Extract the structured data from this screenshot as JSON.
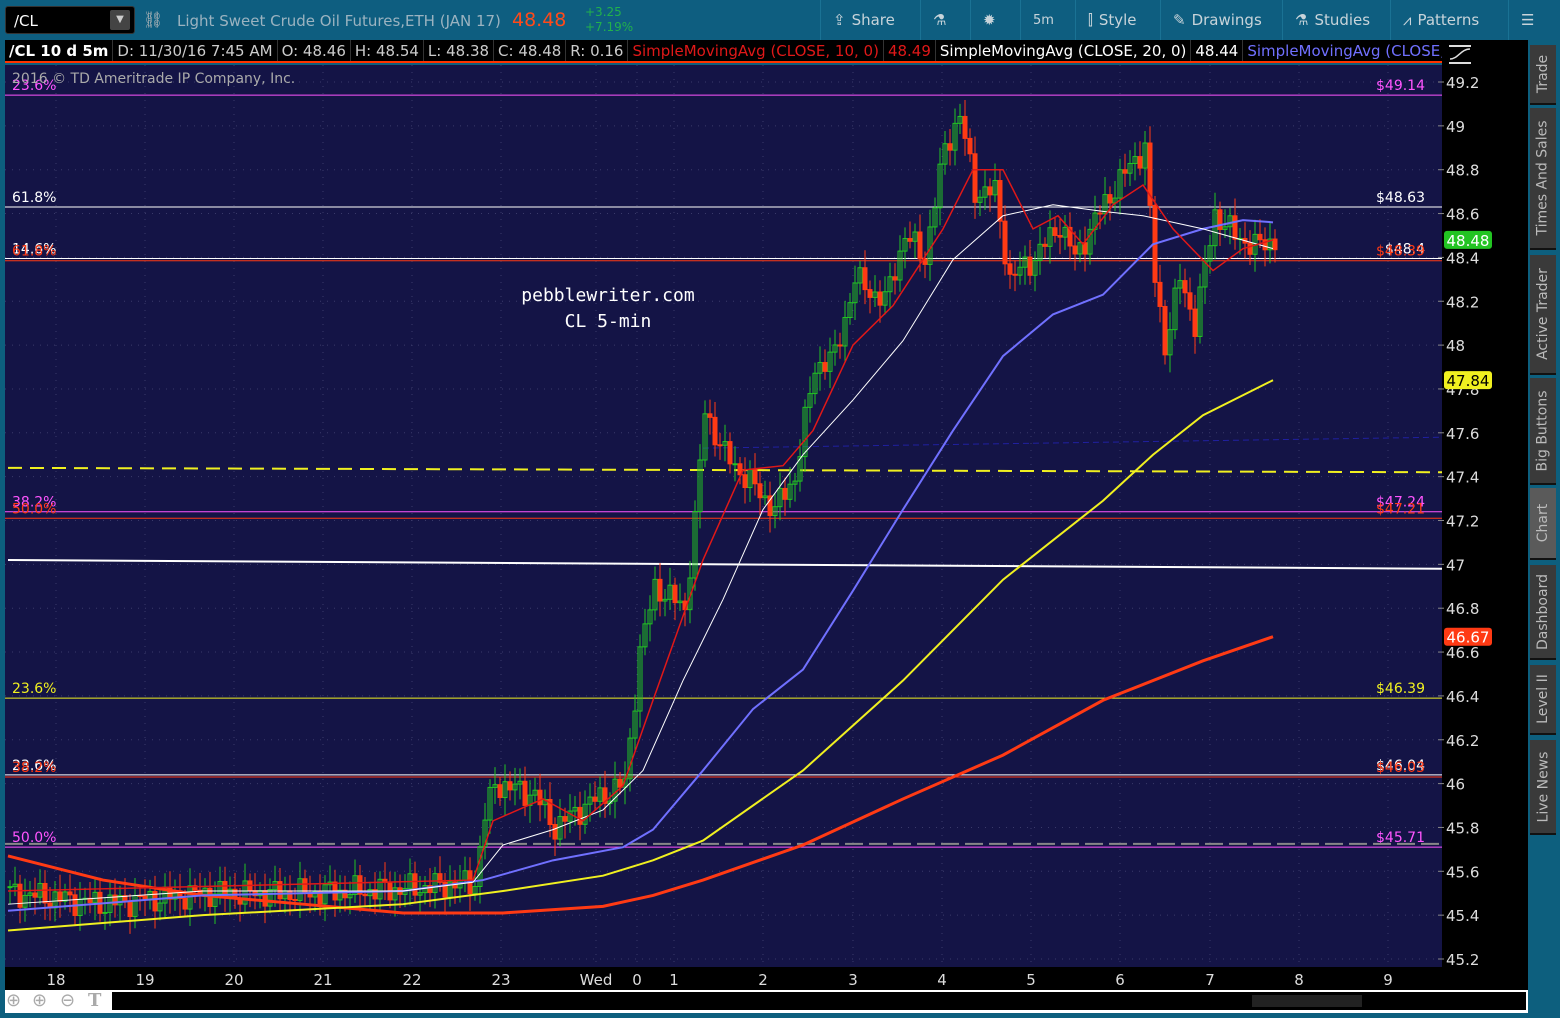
{
  "toolbar": {
    "symbol": "/CL",
    "description": "Light Sweet Crude Oil Futures,ETH (JAN 17)",
    "last": "48.48",
    "change": "+3.25",
    "change_pct": "+7.19%",
    "share": "Share",
    "interval": "5m",
    "style": "Style",
    "drawings": "Drawings",
    "studies": "Studies",
    "patterns": "Patterns"
  },
  "info": {
    "title": "/CL 10 d 5m",
    "date": "D: 11/30/16 7:45 AM",
    "open": "O: 48.46",
    "high": "H: 48.54",
    "low": "L: 48.38",
    "close": "C: 48.48",
    "range": "R: 0.16",
    "sma10": "SimpleMovingAvg (CLOSE, 10, 0)",
    "sma10_val": "48.49",
    "sma20": "SimpleMovingAvg (CLOSE, 20, 0)",
    "sma20_val": "48.44",
    "sma3": "SimpleMovingAvg (CLOSE,..."
  },
  "copyright": "2016 © TD Ameritrade IP Company, Inc.",
  "watermark": {
    "line1": "pebblewriter.com",
    "line2": "CL 5-min"
  },
  "tabs": [
    "Trade",
    "Times And Sales",
    "Active Trader",
    "Big Buttons",
    "Chart",
    "Dashboard",
    "Level II",
    "Live News"
  ],
  "colors": {
    "bg": "#141446",
    "up": "#22c422",
    "down": "#ff3a14",
    "sma10": "#e01818",
    "sma20": "#ffffff",
    "sma50": "#7070ff",
    "sma100": "#f0f020",
    "sma200": "#ff3a14"
  },
  "chart_data": {
    "type": "candlestick",
    "ylim": [
      45.2,
      49.2
    ],
    "yticks": [
      "49.2",
      "49",
      "48.8",
      "48.6",
      "48.4",
      "48.2",
      "48",
      "47.8",
      "47.6",
      "47.4",
      "47.2",
      "47",
      "46.8",
      "46.6",
      "46.4",
      "46.2",
      "46",
      "45.8",
      "45.6",
      "45.4",
      "45.2"
    ],
    "xticks": [
      {
        "label": "18",
        "bar": 9.6
      },
      {
        "label": "19",
        "bar": 27.4
      },
      {
        "label": "20",
        "bar": 45.2
      },
      {
        "label": "21",
        "bar": 63
      },
      {
        "label": "22",
        "bar": 80.8
      },
      {
        "label": "23",
        "bar": 98.6
      },
      {
        "label": "Wed",
        "bar": 117.6
      },
      {
        "label": "0",
        "bar": 125.8
      },
      {
        "label": "1",
        "bar": 133.2
      },
      {
        "label": "2",
        "bar": 151
      },
      {
        "label": "3",
        "bar": 169
      },
      {
        "label": "4",
        "bar": 186.8
      },
      {
        "label": "5",
        "bar": 204.6
      },
      {
        "label": "6",
        "bar": 222.4
      },
      {
        "label": "7",
        "bar": 240.4
      },
      {
        "label": "8",
        "bar": 258.2
      },
      {
        "label": "9",
        "bar": 276
      }
    ],
    "close_keypoints": [
      [
        1,
        45.5
      ],
      [
        19,
        45.45
      ],
      [
        39,
        45.5
      ],
      [
        59,
        45.5
      ],
      [
        79,
        45.52
      ],
      [
        93,
        45.55
      ],
      [
        95,
        45.85
      ],
      [
        97,
        46.0
      ],
      [
        105,
        45.95
      ],
      [
        109,
        45.8
      ],
      [
        115,
        45.9
      ],
      [
        123,
        46.0
      ],
      [
        126,
        46.6
      ],
      [
        129,
        46.9
      ],
      [
        135,
        46.8
      ],
      [
        137,
        47.2
      ],
      [
        139,
        47.7
      ],
      [
        143,
        47.5
      ],
      [
        147,
        47.4
      ],
      [
        153,
        47.25
      ],
      [
        157,
        47.4
      ],
      [
        161,
        47.9
      ],
      [
        165,
        47.95
      ],
      [
        169,
        48.3
      ],
      [
        175,
        48.2
      ],
      [
        179,
        48.5
      ],
      [
        183,
        48.4
      ],
      [
        187,
        48.9
      ],
      [
        190,
        49.05
      ],
      [
        193,
        48.7
      ],
      [
        197,
        48.7
      ],
      [
        200,
        48.3
      ],
      [
        205,
        48.4
      ],
      [
        210,
        48.55
      ],
      [
        213,
        48.4
      ],
      [
        219,
        48.65
      ],
      [
        225,
        48.85
      ],
      [
        227,
        48.9
      ],
      [
        229,
        48.3
      ],
      [
        231,
        48.0
      ],
      [
        234,
        48.3
      ],
      [
        237,
        48.1
      ],
      [
        241,
        48.6
      ],
      [
        245,
        48.5
      ],
      [
        249,
        48.45
      ],
      [
        253,
        48.48
      ]
    ],
    "series": [
      {
        "name": "SMA200",
        "color": "#ff3a14",
        "width": 3,
        "points": [
          [
            0,
            45.67
          ],
          [
            19,
            45.56
          ],
          [
            39,
            45.49
          ],
          [
            59,
            45.45
          ],
          [
            79,
            45.41
          ],
          [
            99,
            45.41
          ],
          [
            119,
            45.44
          ],
          [
            129,
            45.49
          ],
          [
            139,
            45.56
          ],
          [
            159,
            45.72
          ],
          [
            179,
            45.93
          ],
          [
            199,
            46.13
          ],
          [
            219,
            46.38
          ],
          [
            239,
            46.56
          ],
          [
            253,
            46.67
          ]
        ]
      },
      {
        "name": "SMA100",
        "color": "#f0f020",
        "width": 2,
        "points": [
          [
            0,
            45.33
          ],
          [
            39,
            45.4
          ],
          [
            79,
            45.45
          ],
          [
            99,
            45.51
          ],
          [
            119,
            45.58
          ],
          [
            129,
            45.65
          ],
          [
            139,
            45.74
          ],
          [
            159,
            46.06
          ],
          [
            179,
            46.47
          ],
          [
            199,
            46.93
          ],
          [
            219,
            47.29
          ],
          [
            229,
            47.5
          ],
          [
            239,
            47.68
          ],
          [
            253,
            47.84
          ]
        ]
      },
      {
        "name": "SMA50",
        "color": "#7070ff",
        "width": 2,
        "points": [
          [
            0,
            45.42
          ],
          [
            39,
            45.49
          ],
          [
            79,
            45.51
          ],
          [
            95,
            45.56
          ],
          [
            109,
            45.65
          ],
          [
            123,
            45.71
          ],
          [
            129,
            45.79
          ],
          [
            139,
            46.06
          ],
          [
            149,
            46.34
          ],
          [
            159,
            46.52
          ],
          [
            169,
            46.88
          ],
          [
            179,
            47.25
          ],
          [
            189,
            47.61
          ],
          [
            199,
            47.95
          ],
          [
            209,
            48.14
          ],
          [
            219,
            48.23
          ],
          [
            229,
            48.46
          ],
          [
            239,
            48.53
          ],
          [
            247,
            48.57
          ],
          [
            253,
            48.56
          ]
        ]
      },
      {
        "name": "SMA20",
        "color": "#ffffff",
        "width": 1,
        "points": [
          [
            0,
            45.45
          ],
          [
            39,
            45.51
          ],
          [
            79,
            45.51
          ],
          [
            93,
            45.55
          ],
          [
            99,
            45.72
          ],
          [
            109,
            45.79
          ],
          [
            119,
            45.88
          ],
          [
            127,
            46.06
          ],
          [
            135,
            46.47
          ],
          [
            143,
            46.84
          ],
          [
            151,
            47.25
          ],
          [
            159,
            47.5
          ],
          [
            169,
            47.75
          ],
          [
            179,
            48.02
          ],
          [
            189,
            48.39
          ],
          [
            199,
            48.59
          ],
          [
            209,
            48.64
          ],
          [
            219,
            48.61
          ],
          [
            227,
            48.59
          ],
          [
            231,
            48.57
          ],
          [
            239,
            48.53
          ],
          [
            253,
            48.44
          ]
        ]
      },
      {
        "name": "SMA10",
        "color": "#e01818",
        "width": 1.5,
        "points": [
          [
            0,
            45.51
          ],
          [
            93,
            45.56
          ],
          [
            97,
            45.83
          ],
          [
            107,
            45.93
          ],
          [
            115,
            45.83
          ],
          [
            123,
            45.99
          ],
          [
            129,
            46.38
          ],
          [
            139,
            47.02
          ],
          [
            147,
            47.43
          ],
          [
            155,
            47.45
          ],
          [
            161,
            47.61
          ],
          [
            169,
            48.0
          ],
          [
            177,
            48.18
          ],
          [
            187,
            48.53
          ],
          [
            193,
            48.8
          ],
          [
            199,
            48.8
          ],
          [
            205,
            48.53
          ],
          [
            210,
            48.59
          ],
          [
            215,
            48.46
          ],
          [
            221,
            48.64
          ],
          [
            227,
            48.73
          ],
          [
            233,
            48.53
          ],
          [
            241,
            48.34
          ],
          [
            247,
            48.44
          ],
          [
            253,
            48.48
          ]
        ]
      }
    ],
    "trendlines": [
      {
        "name": "yellow-dashed-trendline",
        "color": "#f0f020",
        "width": 2,
        "dash": "14,8",
        "from": [
          0,
          47.44
        ],
        "to": [
          287,
          47.42
        ]
      },
      {
        "name": "white-trendline",
        "color": "#ffffff",
        "width": 2,
        "dash": "",
        "from": [
          0,
          47.02
        ],
        "to": [
          287,
          46.98
        ]
      },
      {
        "name": "navy-dashed-trendline",
        "color": "#2020a0",
        "width": 1,
        "dash": "6,4",
        "from": [
          139,
          47.53
        ],
        "to": [
          287,
          47.58
        ]
      }
    ],
    "fib_levels": [
      {
        "price": 49.14,
        "color": "#ff55ff",
        "left": "23.6%",
        "right": "$49.14"
      },
      {
        "price": 48.63,
        "color": "#ffffff",
        "left": "61.8%",
        "right": "$48.63"
      },
      {
        "price": 48.395,
        "color": "#ffffff",
        "left": "14.6%",
        "right": "$48.4"
      },
      {
        "price": 48.385,
        "color": "#ff3a14",
        "left": "61.8%",
        "right": "$48.39"
      },
      {
        "price": 47.24,
        "color": "#ff55ff",
        "left": "38.2%",
        "right": "$47.24"
      },
      {
        "price": 47.21,
        "color": "#ff3a14",
        "left": "50.0%",
        "right": "$47.21"
      },
      {
        "price": 46.39,
        "color": "#f0f020",
        "left": "23.6%",
        "right": "$46.39"
      },
      {
        "price": 46.04,
        "color": "#ffffff",
        "left": "23.6%",
        "right": "$46.04"
      },
      {
        "price": 46.03,
        "color": "#ff3a14",
        "left": "38.2%",
        "right": "$46.03"
      },
      {
        "price": 45.71,
        "color": "#ff55ff",
        "left": "50.0%",
        "right": "$45.71"
      }
    ],
    "price_badges": [
      {
        "value": "48.48",
        "price": 48.48,
        "bg": "#22c422",
        "fg": "#fff"
      },
      {
        "value": "47.84",
        "price": 47.84,
        "bg": "#f0f020",
        "fg": "#000"
      },
      {
        "value": "46.67",
        "price": 46.67,
        "bg": "#ff3a14",
        "fg": "#fff"
      }
    ]
  }
}
